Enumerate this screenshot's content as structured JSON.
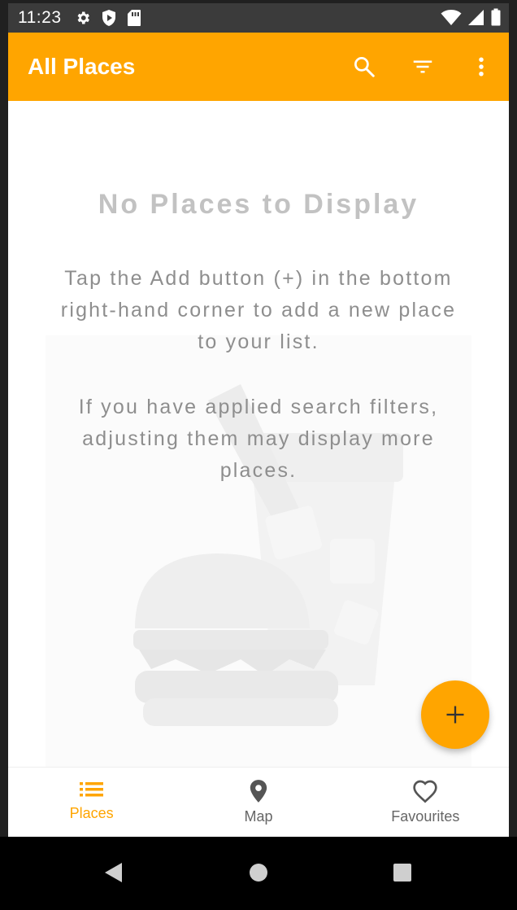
{
  "status_bar": {
    "time": "11:23",
    "icons_left": [
      "gear-icon",
      "shield-play-icon",
      "sd-card-icon"
    ],
    "icons_right": [
      "wifi-icon",
      "signal-icon",
      "battery-icon"
    ]
  },
  "app_bar": {
    "title": "All Places",
    "actions": [
      "search-icon",
      "filter-icon",
      "more-vert-icon"
    ]
  },
  "empty_state": {
    "title": "No Places to Display",
    "paragraph_1": "Tap the Add button (+) in the bottom right-hand corner to add a new place to your list.",
    "paragraph_2": "If you have applied search filters, adjusting them may display more places."
  },
  "fab": {
    "icon": "plus-icon"
  },
  "bottom_nav": {
    "items": [
      {
        "label": "Places",
        "icon": "list-icon",
        "active": true
      },
      {
        "label": "Map",
        "icon": "location-pin-icon",
        "active": false
      },
      {
        "label": "Favourites",
        "icon": "heart-outline-icon",
        "active": false
      }
    ]
  },
  "system_nav": [
    "back-icon",
    "home-icon",
    "recents-icon"
  ],
  "colors": {
    "accent": "#ffa500",
    "status_bar": "#3b3b3b",
    "title_gray": "#c2c2c2",
    "body_gray": "#8e8e8e"
  }
}
